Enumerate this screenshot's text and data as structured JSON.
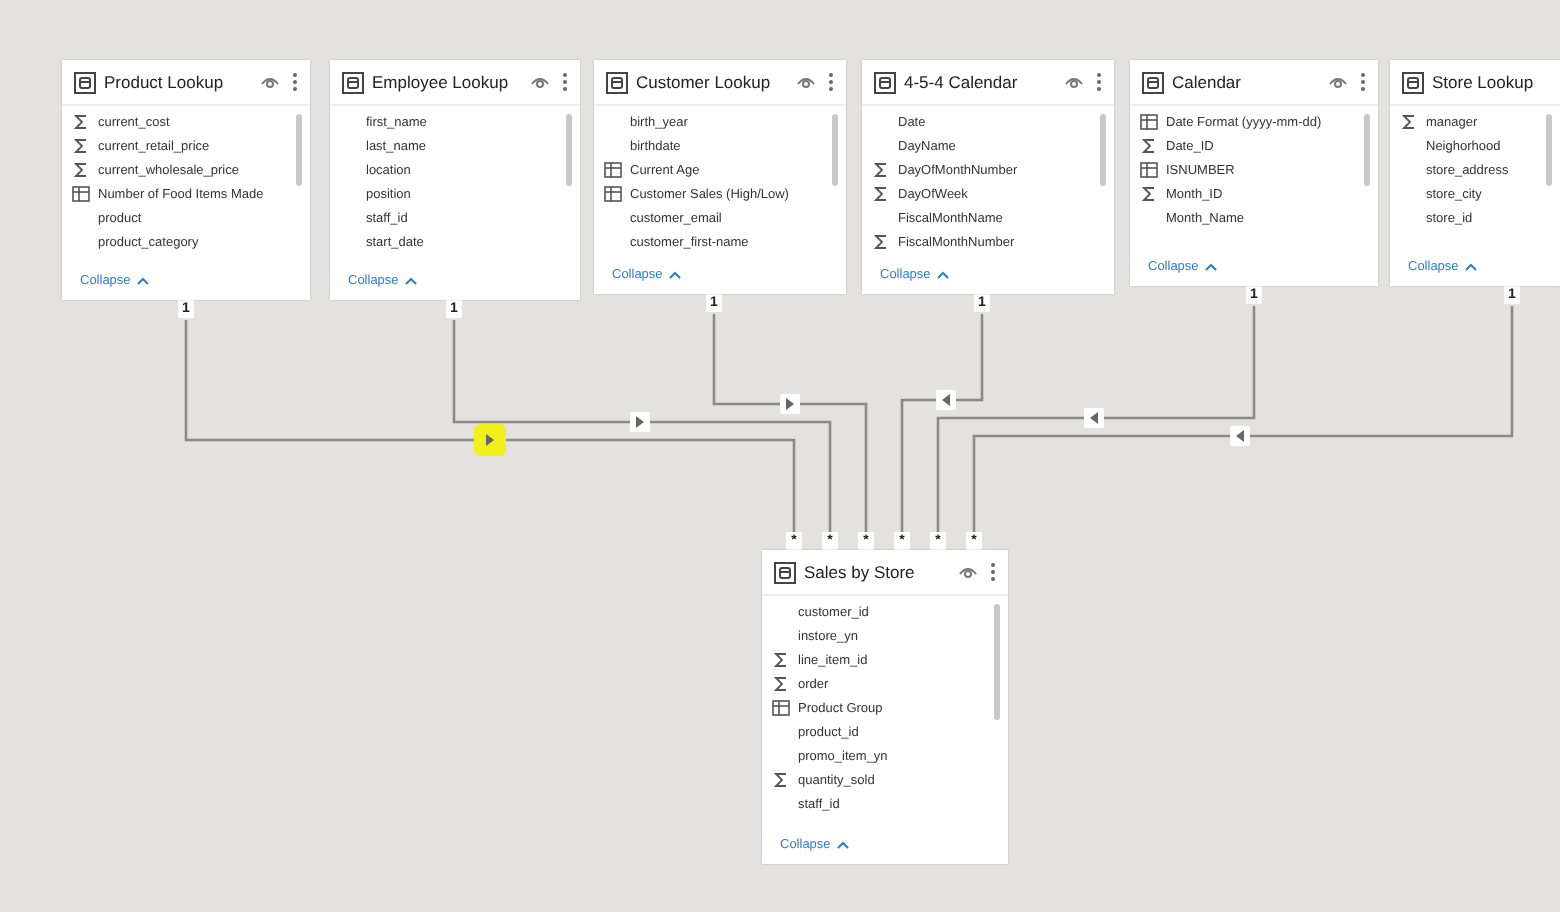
{
  "tables": [
    {
      "name": "Product Lookup",
      "fields": [
        {
          "name": "current_cost",
          "kind": "sum"
        },
        {
          "name": "current_retail_price",
          "kind": "sum"
        },
        {
          "name": "current_wholesale_price",
          "kind": "sum"
        },
        {
          "name": "Number of Food Items Made",
          "kind": "calc"
        },
        {
          "name": "product",
          "kind": "text"
        },
        {
          "name": "product_category",
          "kind": "text"
        }
      ],
      "collapse": "Collapse",
      "cardinality": "1"
    },
    {
      "name": "Employee Lookup",
      "fields": [
        {
          "name": "first_name",
          "kind": "text"
        },
        {
          "name": "last_name",
          "kind": "text"
        },
        {
          "name": "location",
          "kind": "text"
        },
        {
          "name": "position",
          "kind": "text"
        },
        {
          "name": "staff_id",
          "kind": "text"
        },
        {
          "name": "start_date",
          "kind": "text"
        }
      ],
      "collapse": "Collapse",
      "cardinality": "1"
    },
    {
      "name": "Customer Lookup",
      "fields": [
        {
          "name": "birth_year",
          "kind": "text"
        },
        {
          "name": "birthdate",
          "kind": "text"
        },
        {
          "name": "Current Age",
          "kind": "calc"
        },
        {
          "name": "Customer Sales (High/Low)",
          "kind": "calc"
        },
        {
          "name": "customer_email",
          "kind": "text"
        },
        {
          "name": "customer_first-name",
          "kind": "text"
        }
      ],
      "collapse": "Collapse",
      "cardinality": "1"
    },
    {
      "name": "4-5-4 Calendar",
      "fields": [
        {
          "name": "Date",
          "kind": "text"
        },
        {
          "name": "DayName",
          "kind": "text"
        },
        {
          "name": "DayOfMonthNumber",
          "kind": "sum"
        },
        {
          "name": "DayOfWeek",
          "kind": "sum"
        },
        {
          "name": "FiscalMonthName",
          "kind": "text"
        },
        {
          "name": "FiscalMonthNumber",
          "kind": "sum"
        }
      ],
      "collapse": "Collapse",
      "cardinality": "1"
    },
    {
      "name": "Calendar",
      "fields": [
        {
          "name": "Date Format (yyyy-mm-dd)",
          "kind": "calc"
        },
        {
          "name": "Date_ID",
          "kind": "sum"
        },
        {
          "name": "ISNUMBER",
          "kind": "calc"
        },
        {
          "name": "Month_ID",
          "kind": "sum"
        },
        {
          "name": "Month_Name",
          "kind": "text"
        }
      ],
      "collapse": "Collapse",
      "cardinality": "1"
    },
    {
      "name": "Store Lookup",
      "fields": [
        {
          "name": "manager",
          "kind": "sum"
        },
        {
          "name": "Neighorhood",
          "kind": "text"
        },
        {
          "name": "store_address",
          "kind": "text"
        },
        {
          "name": "store_city",
          "kind": "text"
        },
        {
          "name": "store_id",
          "kind": "text"
        }
      ],
      "collapse": "Collapse",
      "cardinality": "1"
    }
  ],
  "fact_table": {
    "name": "Sales by Store",
    "many_labels": [
      "*",
      "*",
      "*",
      "*",
      "*",
      "*"
    ],
    "fields": [
      {
        "name": "customer_id",
        "kind": "text"
      },
      {
        "name": "instore_yn",
        "kind": "text"
      },
      {
        "name": "line_item_id",
        "kind": "sum"
      },
      {
        "name": "order",
        "kind": "sum"
      },
      {
        "name": "Product Group",
        "kind": "calc"
      },
      {
        "name": "product_id",
        "kind": "text"
      },
      {
        "name": "promo_item_yn",
        "kind": "text"
      },
      {
        "name": "quantity_sold",
        "kind": "sum"
      },
      {
        "name": "staff_id",
        "kind": "text"
      }
    ],
    "collapse": "Collapse"
  },
  "relationships": [
    {
      "kind": "rightward",
      "highlighted": true
    },
    {
      "kind": "rightward",
      "highlighted": false
    },
    {
      "kind": "rightward",
      "highlighted": false
    },
    {
      "kind": "leftward",
      "highlighted": false
    },
    {
      "kind": "leftward",
      "highlighted": false
    },
    {
      "kind": "leftward",
      "highlighted": false
    }
  ]
}
